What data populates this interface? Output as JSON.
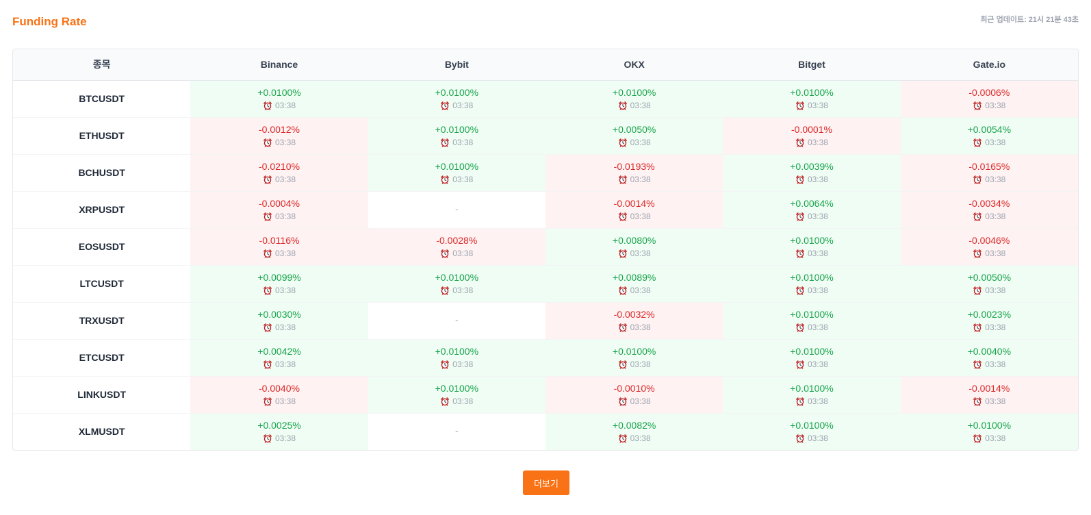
{
  "page": {
    "title": "Funding Rate",
    "updated_label": "최근 업데이트: 21시 21분 43초"
  },
  "table": {
    "headers": [
      "종목",
      "Binance",
      "Bybit",
      "OKX",
      "Bitget",
      "Gate.io"
    ],
    "rows": [
      {
        "symbol": "BTCUSDT",
        "cells": [
          {
            "rate": "+0.0100%",
            "time": "03:38",
            "status": "pos"
          },
          {
            "rate": "+0.0100%",
            "time": "03:38",
            "status": "pos"
          },
          {
            "rate": "+0.0100%",
            "time": "03:38",
            "status": "pos"
          },
          {
            "rate": "+0.0100%",
            "time": "03:38",
            "status": "pos"
          },
          {
            "rate": "-0.0006%",
            "time": "03:38",
            "status": "neg"
          }
        ]
      },
      {
        "symbol": "ETHUSDT",
        "cells": [
          {
            "rate": "-0.0012%",
            "time": "03:38",
            "status": "neg"
          },
          {
            "rate": "+0.0100%",
            "time": "03:38",
            "status": "pos"
          },
          {
            "rate": "+0.0050%",
            "time": "03:38",
            "status": "pos"
          },
          {
            "rate": "-0.0001%",
            "time": "03:38",
            "status": "neg"
          },
          {
            "rate": "+0.0054%",
            "time": "03:38",
            "status": "pos"
          }
        ]
      },
      {
        "symbol": "BCHUSDT",
        "cells": [
          {
            "rate": "-0.0210%",
            "time": "03:38",
            "status": "neg"
          },
          {
            "rate": "+0.0100%",
            "time": "03:38",
            "status": "pos"
          },
          {
            "rate": "-0.0193%",
            "time": "03:38",
            "status": "neg"
          },
          {
            "rate": "+0.0039%",
            "time": "03:38",
            "status": "pos"
          },
          {
            "rate": "-0.0165%",
            "time": "03:38",
            "status": "neg"
          }
        ]
      },
      {
        "symbol": "XRPUSDT",
        "cells": [
          {
            "rate": "-0.0004%",
            "time": "03:38",
            "status": "neg"
          },
          {
            "rate": "-",
            "time": "",
            "status": "empty"
          },
          {
            "rate": "-0.0014%",
            "time": "03:38",
            "status": "neg"
          },
          {
            "rate": "+0.0064%",
            "time": "03:38",
            "status": "pos"
          },
          {
            "rate": "-0.0034%",
            "time": "03:38",
            "status": "neg"
          }
        ]
      },
      {
        "symbol": "EOSUSDT",
        "cells": [
          {
            "rate": "-0.0116%",
            "time": "03:38",
            "status": "neg"
          },
          {
            "rate": "-0.0028%",
            "time": "03:38",
            "status": "neg"
          },
          {
            "rate": "+0.0080%",
            "time": "03:38",
            "status": "pos"
          },
          {
            "rate": "+0.0100%",
            "time": "03:38",
            "status": "pos"
          },
          {
            "rate": "-0.0046%",
            "time": "03:38",
            "status": "neg"
          }
        ]
      },
      {
        "symbol": "LTCUSDT",
        "cells": [
          {
            "rate": "+0.0099%",
            "time": "03:38",
            "status": "pos"
          },
          {
            "rate": "+0.0100%",
            "time": "03:38",
            "status": "pos"
          },
          {
            "rate": "+0.0089%",
            "time": "03:38",
            "status": "pos"
          },
          {
            "rate": "+0.0100%",
            "time": "03:38",
            "status": "pos"
          },
          {
            "rate": "+0.0050%",
            "time": "03:38",
            "status": "pos"
          }
        ]
      },
      {
        "symbol": "TRXUSDT",
        "cells": [
          {
            "rate": "+0.0030%",
            "time": "03:38",
            "status": "pos"
          },
          {
            "rate": "-",
            "time": "",
            "status": "empty"
          },
          {
            "rate": "-0.0032%",
            "time": "03:38",
            "status": "neg"
          },
          {
            "rate": "+0.0100%",
            "time": "03:38",
            "status": "pos"
          },
          {
            "rate": "+0.0023%",
            "time": "03:38",
            "status": "pos"
          }
        ]
      },
      {
        "symbol": "ETCUSDT",
        "cells": [
          {
            "rate": "+0.0042%",
            "time": "03:38",
            "status": "pos"
          },
          {
            "rate": "+0.0100%",
            "time": "03:38",
            "status": "pos"
          },
          {
            "rate": "+0.0100%",
            "time": "03:38",
            "status": "pos"
          },
          {
            "rate": "+0.0100%",
            "time": "03:38",
            "status": "pos"
          },
          {
            "rate": "+0.0040%",
            "time": "03:38",
            "status": "pos"
          }
        ]
      },
      {
        "symbol": "LINKUSDT",
        "cells": [
          {
            "rate": "-0.0040%",
            "time": "03:38",
            "status": "neg"
          },
          {
            "rate": "+0.0100%",
            "time": "03:38",
            "status": "pos"
          },
          {
            "rate": "-0.0010%",
            "time": "03:38",
            "status": "neg"
          },
          {
            "rate": "+0.0100%",
            "time": "03:38",
            "status": "pos"
          },
          {
            "rate": "-0.0014%",
            "time": "03:38",
            "status": "neg"
          }
        ]
      },
      {
        "symbol": "XLMUSDT",
        "cells": [
          {
            "rate": "+0.0025%",
            "time": "03:38",
            "status": "pos"
          },
          {
            "rate": "-",
            "time": "",
            "status": "empty"
          },
          {
            "rate": "+0.0082%",
            "time": "03:38",
            "status": "pos"
          },
          {
            "rate": "+0.0100%",
            "time": "03:38",
            "status": "pos"
          },
          {
            "rate": "+0.0100%",
            "time": "03:38",
            "status": "pos"
          }
        ]
      }
    ]
  },
  "more_button": {
    "label": "더보기"
  },
  "icons": {
    "time_icon": "alarm-clock-icon"
  },
  "colors": {
    "accent": "#f97316",
    "positive": "#16a34a",
    "negative": "#dc2626",
    "positive_bg": "#f0fdf4",
    "negative_bg": "#fef2f2"
  }
}
